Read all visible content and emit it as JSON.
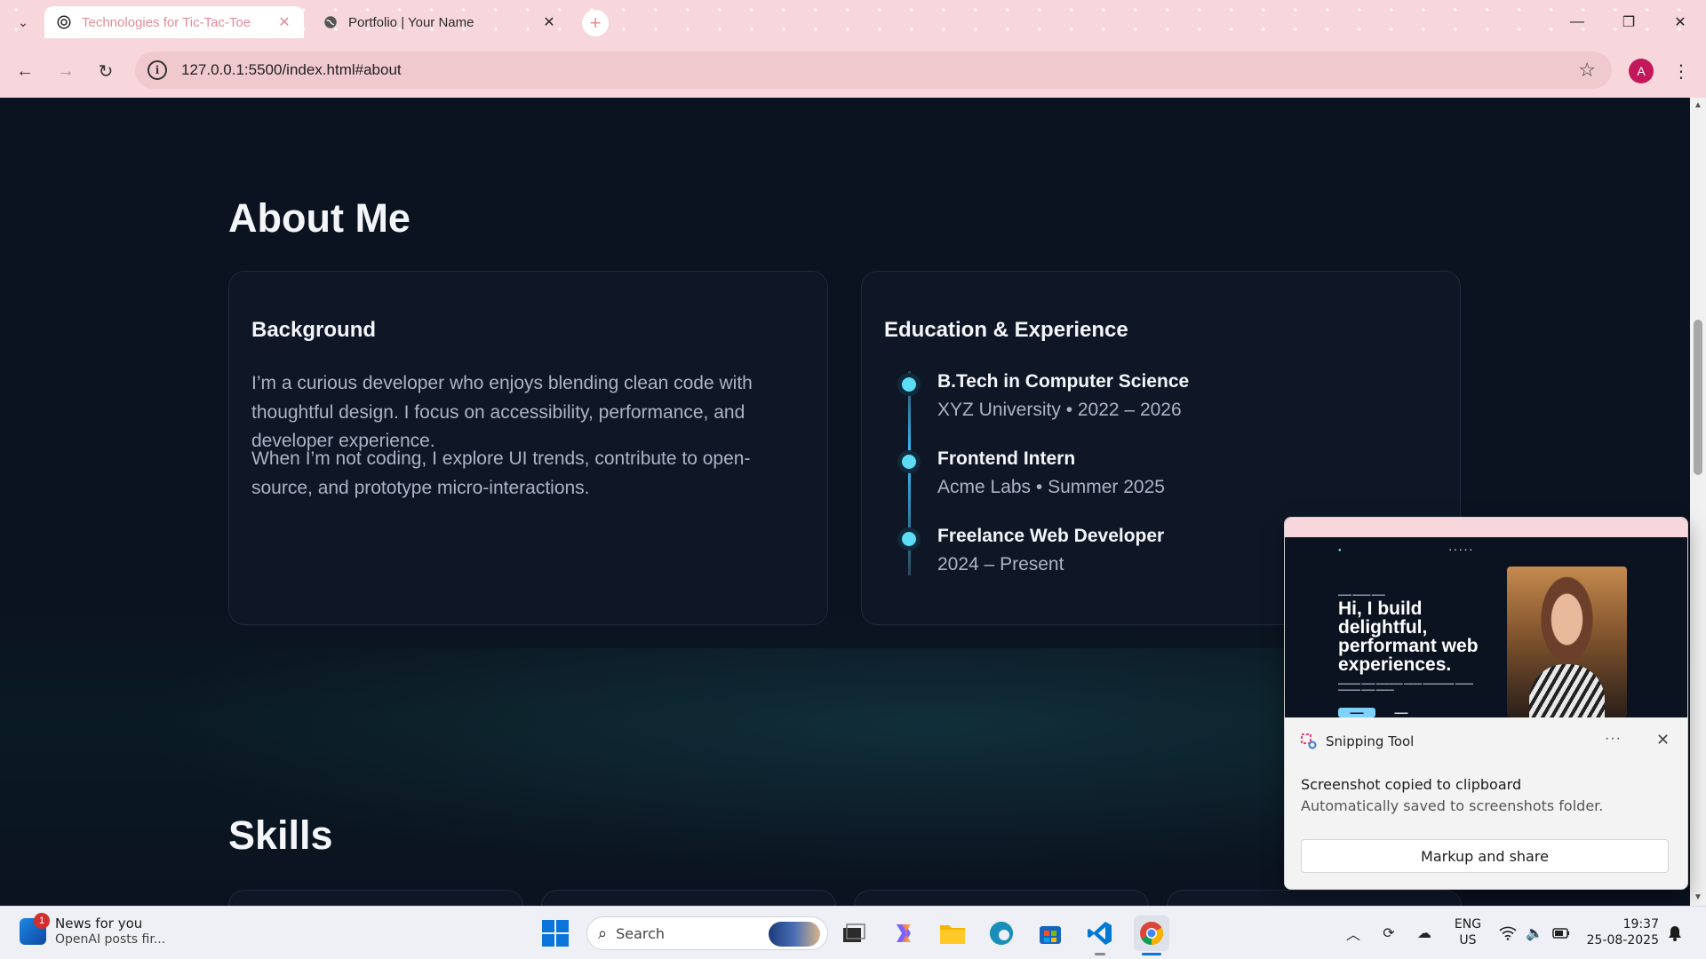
{
  "browser": {
    "tabs": [
      {
        "title": "Technologies for Tic-Tac-Toe",
        "active": true,
        "icon": "chatgpt-icon"
      },
      {
        "title": "Portfolio | Your Name",
        "active": false,
        "icon": "globe-icon"
      }
    ],
    "url": "127.0.0.1:5500/index.html#about",
    "profile_initial": "A",
    "theme_color": "#f8d7dc"
  },
  "page": {
    "about_title": "About Me",
    "background": {
      "heading": "Background",
      "paragraphs": [
        "I’m a curious developer who enjoys blending clean code with thoughtful design. I focus on accessibility, performance, and developer experience.",
        "When I’m not coding, I explore UI trends, contribute to open-source, and prototype micro-interactions."
      ]
    },
    "education": {
      "heading": "Education & Experience",
      "items": [
        {
          "title": "B.Tech in Computer Science",
          "subtitle": "XYZ University • 2022 – 2026"
        },
        {
          "title": "Frontend Intern",
          "subtitle": "Acme Labs • Summer 2025"
        },
        {
          "title": "Freelance Web Developer",
          "subtitle": "2024 – Present"
        }
      ]
    },
    "skills_title": "Skills",
    "colors": {
      "background": "#0b1220",
      "card": "#0f1727",
      "accent": "#5ddcf5"
    }
  },
  "toast": {
    "app": "Snipping Tool",
    "title": "Screenshot copied to clipboard",
    "body": "Automatically saved to screenshots folder.",
    "action": "Markup and share",
    "preview": {
      "hero": "Hi, I build delightful, performant web experiences."
    }
  },
  "taskbar": {
    "news_title": "News for you",
    "news_sub": "OpenAI posts fir...",
    "news_badge": "1",
    "search_placeholder": "Search",
    "lang_line1": "ENG",
    "lang_line2": "US",
    "time": "19:37",
    "date": "25-08-2025"
  }
}
